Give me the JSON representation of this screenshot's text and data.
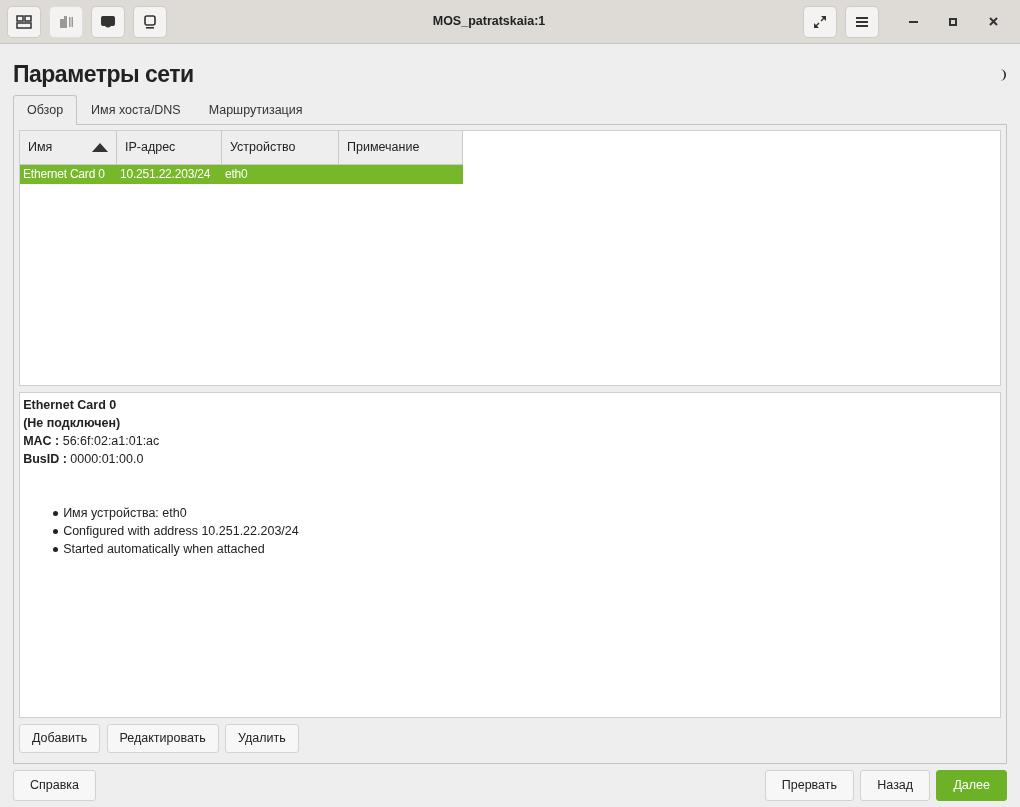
{
  "window": {
    "title": "MOS_patratskaia:1"
  },
  "heading": "Параметры сети",
  "tabs": [
    {
      "label": "Обзор",
      "selected": true
    },
    {
      "label": "Имя хоста/DNS",
      "selected": false
    },
    {
      "label": "Маршрутизация",
      "selected": false
    }
  ],
  "table": {
    "columns": [
      {
        "label": "Имя",
        "sorted": true
      },
      {
        "label": "IP-адрес",
        "sorted": false
      },
      {
        "label": "Устройство",
        "sorted": false
      },
      {
        "label": "Примечание",
        "sorted": false
      }
    ],
    "rows": [
      {
        "cells": [
          "Ethernet Card 0",
          "10.251.22.203/24",
          "eth0",
          ""
        ],
        "selected": true
      }
    ]
  },
  "details": {
    "name": "Ethernet Card 0",
    "status": "(Не подключен)",
    "fields": [
      {
        "label": "MAC :",
        "value": "56:6f:02:a1:01:ac"
      },
      {
        "label": "BusID :",
        "value": "0000:01:00.0"
      }
    ],
    "bullets": [
      "Имя устройства: eth0",
      "Configured with address 10.251.22.203/24",
      "Started automatically when attached"
    ]
  },
  "panel_buttons": [
    "Добавить",
    "Редактировать",
    "Удалить"
  ],
  "footer_buttons": [
    {
      "label": "Справка",
      "primary": false
    },
    {
      "label": "Прервать",
      "primary": false
    },
    {
      "label": "Назад",
      "primary": false
    },
    {
      "label": "Далее",
      "primary": true
    }
  ]
}
